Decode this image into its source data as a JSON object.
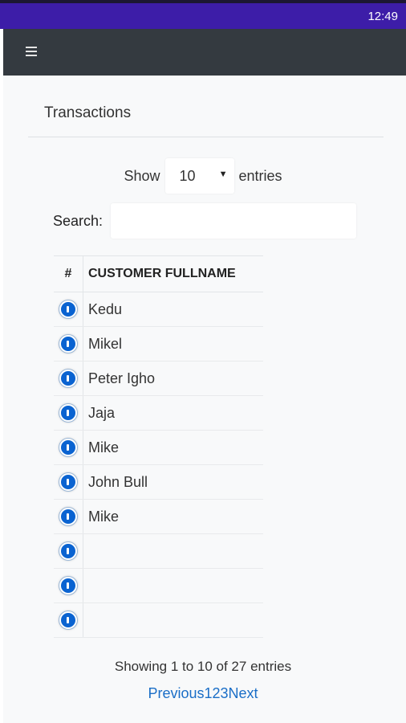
{
  "status_bar": {
    "time": "12:49"
  },
  "page": {
    "title": "Transactions"
  },
  "length": {
    "prefix": "Show",
    "value": "10",
    "suffix": "entries"
  },
  "search": {
    "label": "Search:",
    "value": ""
  },
  "table": {
    "columns": [
      "#",
      "CUSTOMER FULLNAME"
    ],
    "rows": [
      {
        "name": "Kedu"
      },
      {
        "name": "Mikel"
      },
      {
        "name": "Peter Igho"
      },
      {
        "name": "Jaja"
      },
      {
        "name": "Mike"
      },
      {
        "name": "John Bull"
      },
      {
        "name": "Mike"
      },
      {
        "name": ""
      },
      {
        "name": ""
      },
      {
        "name": ""
      }
    ]
  },
  "info": "Showing 1 to 10 of 27 entries",
  "pagination": {
    "previous": "Previous",
    "pages": [
      "1",
      "2",
      "3"
    ],
    "next": "Next"
  }
}
